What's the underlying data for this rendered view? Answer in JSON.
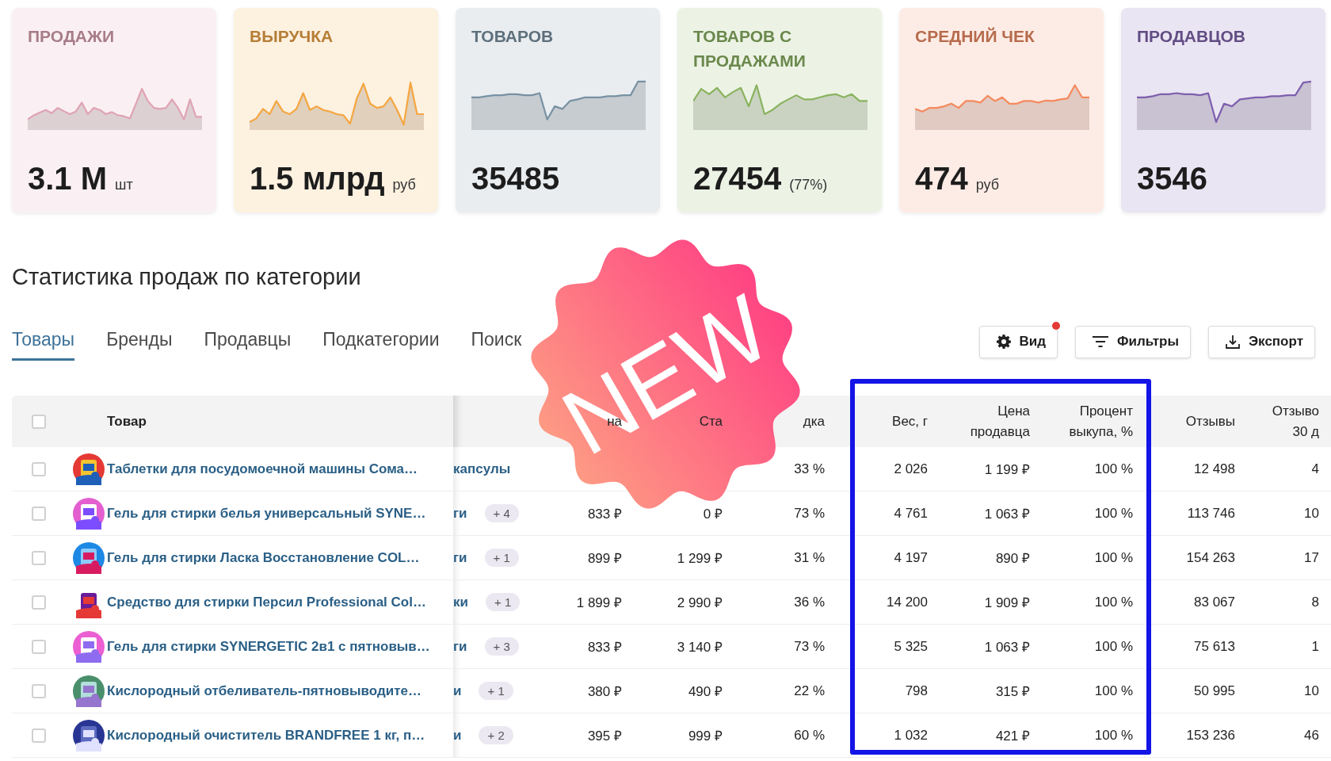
{
  "cards": [
    {
      "title": "ПРОДАЖИ",
      "value": "3.1 M",
      "unit": "шт",
      "color": "#e0a3b4"
    },
    {
      "title": "ВЫРУЧКА",
      "value": "1.5 млрд",
      "unit": "руб",
      "color": "#f5a640"
    },
    {
      "title": "ТОВАРОВ",
      "value": "35485",
      "color": "#7891a3"
    },
    {
      "title": "ТОВАРОВ С ПРОДАЖАМИ",
      "value": "27454",
      "unit": "(77%)",
      "color": "#8ab35e"
    },
    {
      "title": "СРЕДНИЙ ЧЕК",
      "value": "474",
      "unit": "руб",
      "color": "#f58a5e"
    },
    {
      "title": "ПРОДАВЦОВ",
      "value": "3546",
      "color": "#7d5fae"
    }
  ],
  "heading": "Статистика продаж по категории",
  "tabs": [
    {
      "label": "Товары",
      "selected": true
    },
    {
      "label": "Бренды",
      "selected": false
    },
    {
      "label": "Продавцы",
      "selected": false
    },
    {
      "label": "Подкатегории",
      "selected": false
    },
    {
      "label": "Поиск",
      "selected": false
    }
  ],
  "buttons": [
    {
      "kind": "view",
      "label": "Вид",
      "notification": true
    },
    {
      "kind": "filter",
      "label": "Фильтры",
      "notification": false
    },
    {
      "kind": "export",
      "label": "Экспорт",
      "notification": false
    }
  ],
  "header_checkbox": {
    "checked": false
  },
  "columns": [
    {
      "label": [
        "Товар"
      ]
    },
    {
      "label": [
        "на"
      ]
    },
    {
      "label": [
        "Ста"
      ]
    },
    {
      "label": [
        "дка"
      ]
    },
    {
      "label": [
        "Вес, г"
      ]
    },
    {
      "label": [
        "Цена",
        "продавца"
      ]
    },
    {
      "label": [
        "Процент",
        "выкупа, %"
      ]
    },
    {
      "label": [
        "Отзывы"
      ]
    },
    {
      "label": [
        "Отзыво",
        "30 д"
      ]
    }
  ],
  "rows": [
    {
      "checked": false,
      "product": "Таблетки для посудомоечной машины Сома…",
      "column_3": "капсулы",
      "discount": "33 %",
      "weight": "2 026",
      "seller_price": "1 199 ₽",
      "buyout": "100 %",
      "reviews": "12 498",
      "reviews_30d": "4"
    },
    {
      "checked": false,
      "product": "Гель для стирки белья универсальный SYNE…",
      "column_3": "ги",
      "badge": "+ 4",
      "price": "833 ₽",
      "old_price": "0 ₽",
      "discount": "73 %",
      "weight": "4 761",
      "seller_price": "1 063 ₽",
      "buyout": "100 %",
      "reviews": "113 746",
      "reviews_30d": "10"
    },
    {
      "checked": false,
      "product": "Гель для стирки Ласка Восстановление COL…",
      "column_3": "ги",
      "badge": "+ 1",
      "price": "899 ₽",
      "old_price": "1 299 ₽",
      "discount": "31 %",
      "weight": "4 197",
      "seller_price": "890 ₽",
      "buyout": "100 %",
      "reviews": "154 263",
      "reviews_30d": "17"
    },
    {
      "checked": false,
      "product": "Средство для стирки Персил Professional Col…",
      "column_3": "ки",
      "badge": "+ 1",
      "price": "1 899 ₽",
      "old_price": "2 990 ₽",
      "discount": "36 %",
      "weight": "14 200",
      "seller_price": "1 909 ₽",
      "buyout": "100 %",
      "reviews": "83 067",
      "reviews_30d": "8"
    },
    {
      "checked": false,
      "product": "Гель для стирки SYNERGETIC 2в1 с пятновыв…",
      "column_3": "ги",
      "badge": "+ 3",
      "price": "833 ₽",
      "old_price": "3 140 ₽",
      "discount": "73 %",
      "weight": "5 325",
      "seller_price": "1 063 ₽",
      "buyout": "100 %",
      "reviews": "75 613",
      "reviews_30d": "1"
    },
    {
      "checked": false,
      "product": "Кислородный отбеливатель-пятновыводите…",
      "column_3": "и",
      "badge": "+ 1",
      "price": "380 ₽",
      "old_price": "490 ₽",
      "discount": "22 %",
      "weight": "798",
      "seller_price": "315 ₽",
      "buyout": "100 %",
      "reviews": "50 995",
      "reviews_30d": "10"
    },
    {
      "checked": false,
      "product": "Кислородный очиститель BRANDFREE 1 кг, п…",
      "column_3": "и",
      "badge": "+ 2",
      "price": "395 ₽",
      "old_price": "999 ₽",
      "discount": "60 %",
      "weight": "1 032",
      "seller_price": "421 ₽",
      "buyout": "100 %",
      "reviews": "153 236",
      "reviews_30d": "46"
    }
  ],
  "sticker": {
    "text": "NEW"
  }
}
